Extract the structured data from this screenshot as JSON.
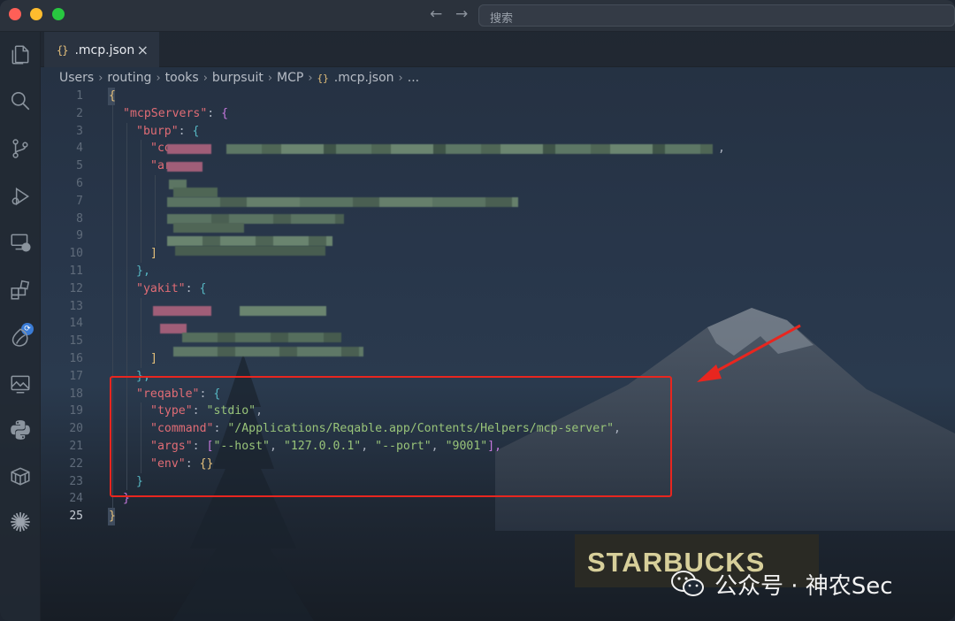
{
  "titlebar": {
    "search_placeholder": "搜索"
  },
  "activitybar": {
    "items": [
      {
        "icon": "files-icon"
      },
      {
        "icon": "search-icon"
      },
      {
        "icon": "source-control-icon"
      },
      {
        "icon": "run-debug-icon"
      },
      {
        "icon": "remote-explorer-icon"
      },
      {
        "icon": "extensions-icon"
      },
      {
        "icon": "leaf-icon"
      },
      {
        "icon": "image-preview-icon"
      },
      {
        "icon": "python-icon"
      },
      {
        "icon": "container-icon"
      },
      {
        "icon": "sparkle-icon"
      }
    ]
  },
  "tabs": [
    {
      "icon_text": "{}",
      "label": ".mcp.json",
      "close": "×"
    }
  ],
  "breadcrumb": {
    "items": [
      "Users",
      "routing",
      "tooks",
      "burpsuit",
      "MCP"
    ],
    "file_icon": "{}",
    "file": ".mcp.json",
    "more": "..."
  },
  "editor": {
    "line_numbers": [
      "1",
      "2",
      "3",
      "4",
      "5",
      "6",
      "7",
      "8",
      "9",
      "10",
      "11",
      "12",
      "13",
      "14",
      "15",
      "16",
      "17",
      "18",
      "19",
      "20",
      "21",
      "22",
      "23",
      "24",
      "25"
    ],
    "active_line": "25",
    "lines": {
      "l1": "{",
      "l2_key": "\"mcpServers\"",
      "l2_colon": ": ",
      "l2_brace": "{",
      "l3_key": "\"burp\"",
      "l3_colon": ": ",
      "l3_brace": "{",
      "l4_partial": "\"co",
      "l4_comma": ",",
      "l5_partial": "\"ar",
      "l10": "]",
      "l11": "},",
      "l12_key": "\"yakit\"",
      "l12_colon": ": ",
      "l12_brace": "{",
      "l16": "]",
      "l17": "},",
      "l18_key": "\"reqable\"",
      "l18_colon": ": ",
      "l18_brace": "{",
      "l19_key": "\"type\"",
      "l19_colon": ": ",
      "l19_val": "\"stdio\"",
      "l19_comma": ",",
      "l20_key": "\"command\"",
      "l20_colon": ": ",
      "l20_val": "\"/Applications/Reqable.app/Contents/Helpers/mcp-server\"",
      "l20_comma": ",",
      "l21_key": "\"args\"",
      "l21_colon": ": ",
      "l21_open": "[",
      "l21_a1": "\"--host\"",
      "l21_sep1": ", ",
      "l21_a2": "\"127.0.0.1\"",
      "l21_sep2": ", ",
      "l21_a3": "\"--port\"",
      "l21_sep3": ", ",
      "l21_a4": "\"9001\"",
      "l21_close": "],",
      "l22_key": "\"env\"",
      "l22_colon": ": ",
      "l22_val": "{}",
      "l23": "}",
      "l24": "}",
      "l25": "}"
    }
  },
  "background": {
    "sign_text": "STARBUCKS"
  },
  "annotation": {
    "box_color": "#e8261f",
    "arrow_color": "#e8261f"
  },
  "watermark": {
    "text": "公众号 · 神农Sec",
    "logo": "wechat-logo"
  }
}
